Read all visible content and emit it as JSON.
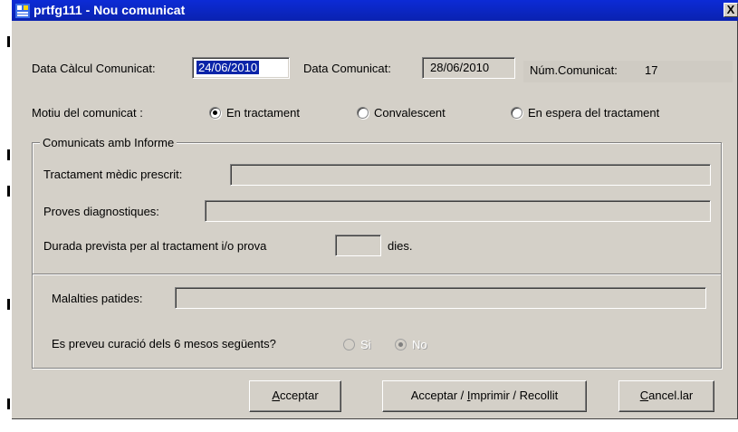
{
  "window": {
    "title": "prtfg111 - Nou comunicat",
    "close_glyph": "X"
  },
  "fields": {
    "data_calcul": {
      "label": "Data Càlcul Comunicat:",
      "value": "24/06/2010"
    },
    "data_comunicat": {
      "label": "Data Comunicat:",
      "value": "28/06/2010"
    },
    "num_comunicat": {
      "label": "Núm.Comunicat:",
      "value": "17"
    }
  },
  "motiu": {
    "label": "Motiu del comunicat :",
    "options": [
      {
        "label": "En tractament",
        "checked": true
      },
      {
        "label": "Convalescent",
        "checked": false
      },
      {
        "label": "En espera del tractament",
        "checked": false
      }
    ]
  },
  "group": {
    "legend": "Comunicats amb Informe",
    "tractament_label": "Tractament mèdic prescrit:",
    "tractament_value": "",
    "proves_label": "Proves diagnostiques:",
    "proves_value": "",
    "durada_label": "Durada prevista per al tractament i/o prova",
    "durada_value": "",
    "durada_suffix": "dies.",
    "malalties_label": "Malalties patides:",
    "malalties_value": "",
    "curacio_label": "Es preveu curació dels 6 mesos següents?",
    "curacio_options": [
      {
        "label": "Si",
        "checked": false
      },
      {
        "label": "No",
        "checked": true
      }
    ]
  },
  "buttons": {
    "acceptar": {
      "prefix": "",
      "mnemonic": "A",
      "rest": "cceptar"
    },
    "acceptar_imprimir": {
      "prefix": "Acceptar / ",
      "mnemonic": "I",
      "rest": "mprimir / Recollit"
    },
    "cancelar": {
      "prefix": "",
      "mnemonic": "C",
      "rest": "ancel.lar"
    }
  },
  "icons": {
    "app": "app-window-icon",
    "close": "close-icon"
  }
}
